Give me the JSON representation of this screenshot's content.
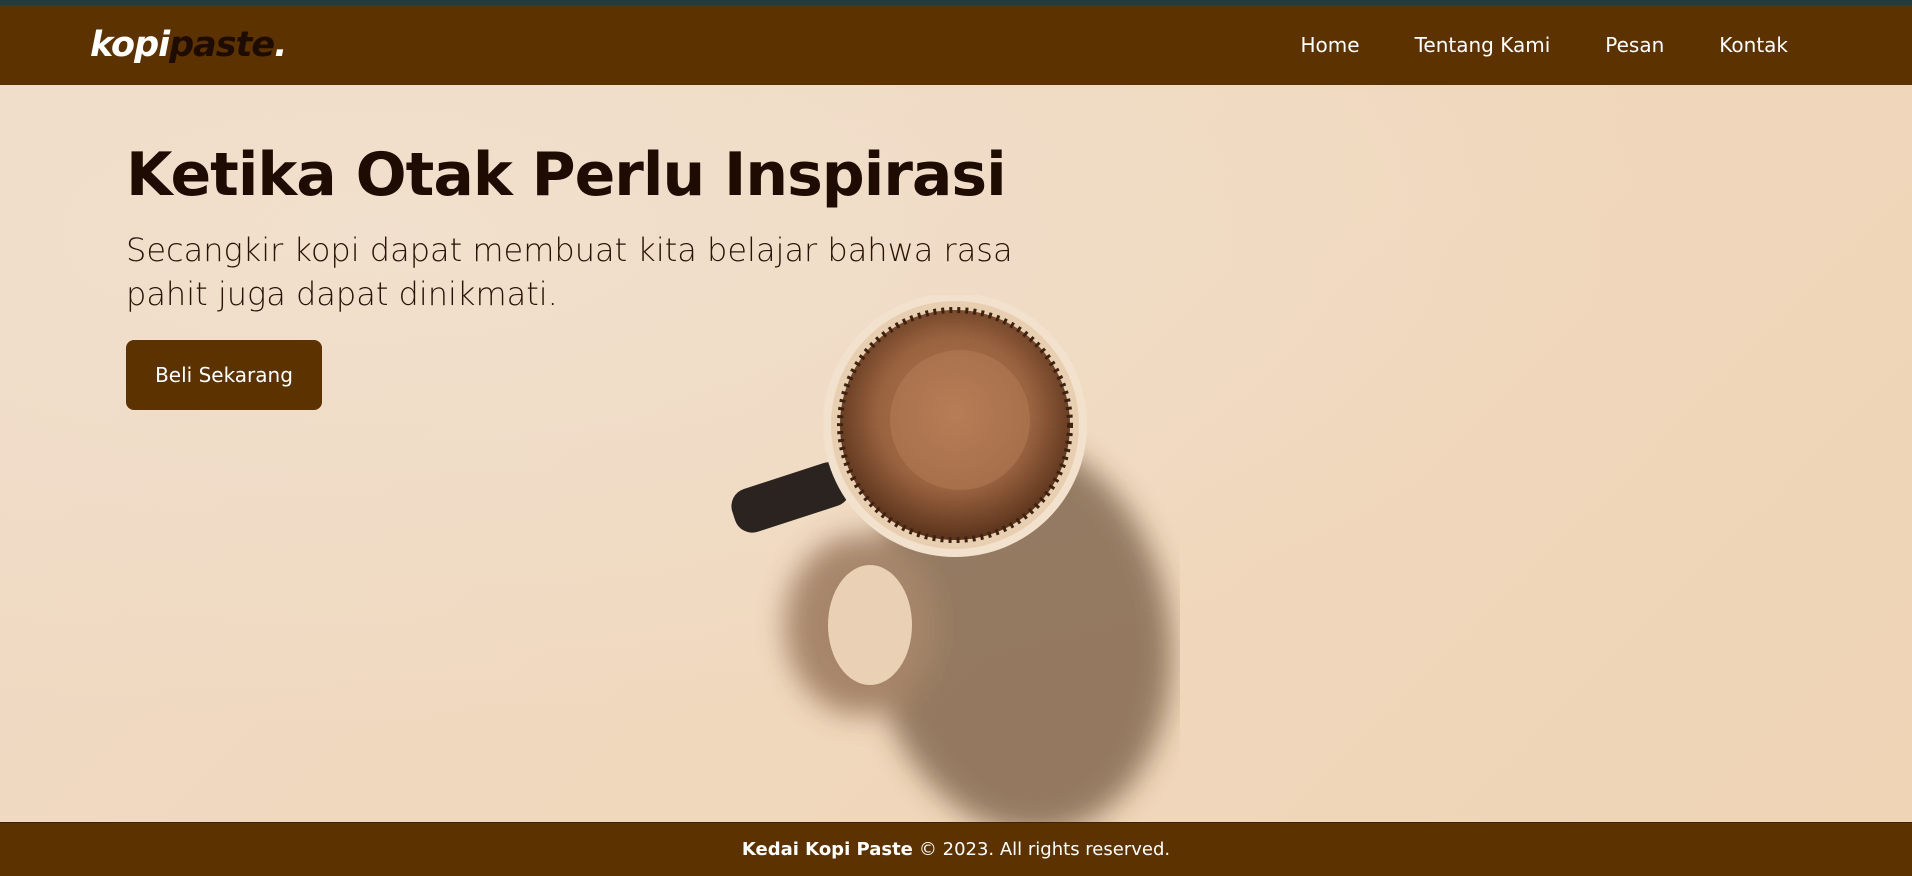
{
  "header": {
    "logo": {
      "part1": "kopi",
      "part2": "paste",
      "dot": "."
    },
    "nav": [
      {
        "label": "Home"
      },
      {
        "label": "Tentang Kami"
      },
      {
        "label": "Pesan"
      },
      {
        "label": "Kontak"
      }
    ]
  },
  "hero": {
    "title": "Ketika Otak Perlu Inspirasi",
    "subtitle": "Secangkir kopi dapat membuat kita belajar bahwa rasa pahit juga dapat dinikmati.",
    "cta_label": "Beli Sekarang"
  },
  "footer": {
    "brand": "Kedai Kopi Paste",
    "text": "© 2023. All rights reserved."
  },
  "colors": {
    "brand_brown": "#5c3300",
    "dark_text": "#1e0b02",
    "hero_bg": "#efdac6"
  },
  "icons": {
    "hero_image": "coffee-mug-top-view"
  }
}
